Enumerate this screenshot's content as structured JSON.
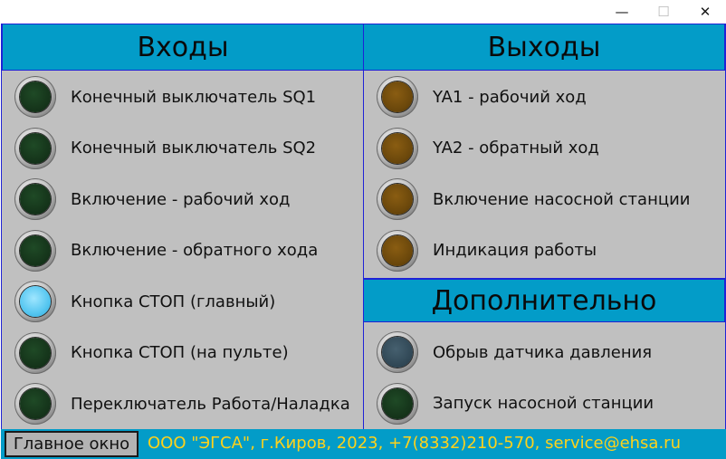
{
  "window": {
    "minimize": "—",
    "maximize": "☐",
    "close": "✕"
  },
  "inputs": {
    "title": "Входы",
    "items": [
      {
        "label": "Конечный выключатель SQ1",
        "lamp": "green"
      },
      {
        "label": "Конечный выключатель SQ2",
        "lamp": "green"
      },
      {
        "label": "Включение - рабочий ход",
        "lamp": "green"
      },
      {
        "label": "Включение - обратного хода",
        "lamp": "green"
      },
      {
        "label": "Кнопка СТОП (главный)",
        "lamp": "blue"
      },
      {
        "label": "Кнопка СТОП (на пульте)",
        "lamp": "green"
      },
      {
        "label": "Переключатель Работа/Наладка",
        "lamp": "green"
      }
    ]
  },
  "outputs": {
    "title": "Выходы",
    "items": [
      {
        "label": "YA1 - рабочий ход",
        "lamp": "amber"
      },
      {
        "label": "YA2 - обратный ход",
        "lamp": "amber"
      },
      {
        "label": "Включение насосной станции",
        "lamp": "amber"
      },
      {
        "label": "Индикация работы",
        "lamp": "amber"
      }
    ]
  },
  "extra": {
    "title": "Дополнительно",
    "items": [
      {
        "label": "Обрыв датчика давления",
        "lamp": "slate"
      },
      {
        "label": "Запуск насосной станции",
        "lamp": "green"
      }
    ]
  },
  "footer": {
    "main_button": "Главное окно",
    "company": "ООО \"ЭГСА\", г.Киров, 2023, +7(8332)210-570, service@ehsa.ru"
  },
  "colors": {
    "header_bg": "#039cc8",
    "panel_bg": "#c0c0c0",
    "border": "#1f22d6",
    "footer_text": "#ffd21a"
  }
}
